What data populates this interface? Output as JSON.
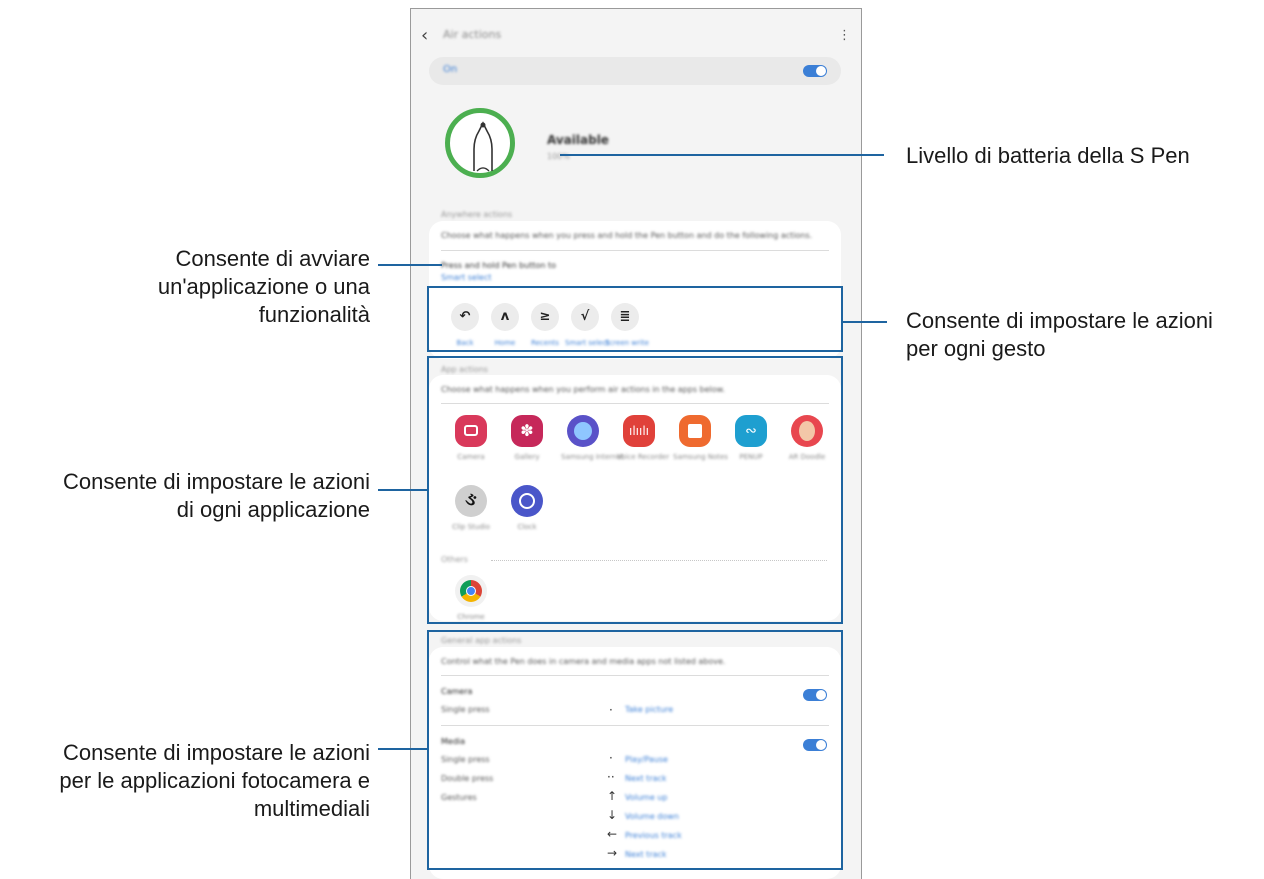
{
  "callouts": {
    "battery": "Livello di batteria della S Pen",
    "launch": [
      "Consente di avviare",
      "un'applicazione o una",
      "funzionalità"
    ],
    "gestures": [
      "Consente di impostare le azioni",
      "per ogni gesto"
    ],
    "apps": [
      "Consente di impostare le azioni",
      "di ogni applicazione"
    ],
    "media": [
      "Consente di impostare le azioni",
      "per le applicazioni fotocamera e",
      "multimediali"
    ]
  },
  "screen": {
    "title": "Air actions",
    "master_toggle_label": "On",
    "status_title": "Available",
    "status_sub": "100%",
    "anywhere_section": "Anywhere actions",
    "anywhere_desc": "Choose what happens when you press and hold the Pen button and do the following actions.",
    "press_hold_title": "Press and hold Pen button to",
    "press_hold_value": "Smart select",
    "gestures": [
      "Back",
      "Home",
      "Recents",
      "Smart select",
      "Screen write"
    ],
    "app_section": "App actions",
    "app_desc": "Choose what happens when you perform air actions in the apps below.",
    "apps": [
      "Camera",
      "Gallery",
      "Samsung Internet",
      "Voice Recorder",
      "Samsung Notes",
      "PENUP",
      "AR Doodle",
      "Clip Studio",
      "Clock"
    ],
    "others_label": "Others",
    "other_apps": [
      "Chrome"
    ],
    "general_section": "General app actions",
    "general_desc": "Control what the Pen does in camera and media apps not listed above.",
    "camera_label": "Camera",
    "camera_rows": [
      {
        "label": "Single press",
        "value": "Take picture"
      }
    ],
    "media_label": "Media",
    "media_rows": [
      {
        "label": "Single press",
        "value": "Play/Pause"
      },
      {
        "label": "Double press",
        "value": "Next track"
      },
      {
        "label": "Gestures",
        "value": "Volume up"
      },
      {
        "label": "",
        "value": "Volume down"
      },
      {
        "label": "",
        "value": "Previous track"
      },
      {
        "label": "",
        "value": "Next track"
      }
    ]
  },
  "colors": {
    "accent": "#3b7fd6",
    "callout_line": "#1e64a0",
    "battery_ring": "#4caf50"
  }
}
